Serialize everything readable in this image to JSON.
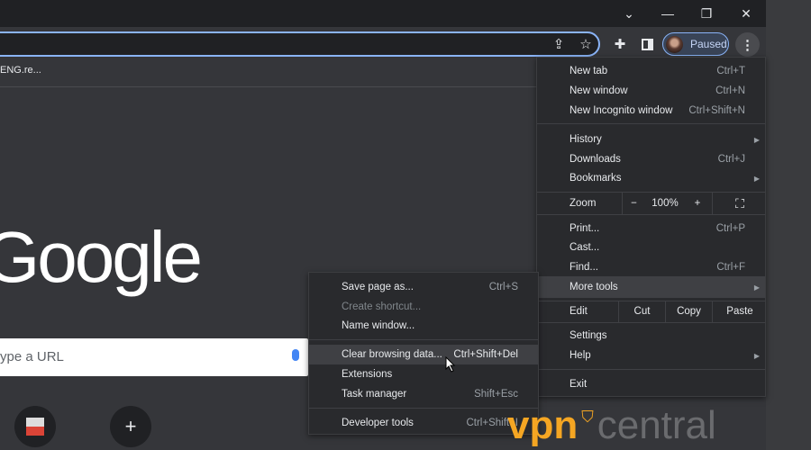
{
  "window": {
    "controls": [
      "chevron-down",
      "minimize",
      "restore",
      "close"
    ]
  },
  "toolbar": {
    "profile_label": "Paused",
    "icons": [
      "share-icon",
      "star-icon",
      "extensions-icon",
      "side-panel-icon",
      "menu-icon"
    ]
  },
  "bookmarks": {
    "item": "ENG.re..."
  },
  "page": {
    "logo": "Google",
    "search_placeholder": "ype a URL"
  },
  "menu": {
    "new_tab": {
      "label": "New tab",
      "shortcut": "Ctrl+T"
    },
    "new_window": {
      "label": "New window",
      "shortcut": "Ctrl+N"
    },
    "incognito": {
      "label": "New Incognito window",
      "shortcut": "Ctrl+Shift+N"
    },
    "history": {
      "label": "History"
    },
    "downloads": {
      "label": "Downloads",
      "shortcut": "Ctrl+J"
    },
    "bookmarks": {
      "label": "Bookmarks"
    },
    "zoom": {
      "label": "Zoom",
      "minus": "−",
      "value": "100%",
      "plus": "+"
    },
    "print": {
      "label": "Print...",
      "shortcut": "Ctrl+P"
    },
    "cast": {
      "label": "Cast..."
    },
    "find": {
      "label": "Find...",
      "shortcut": "Ctrl+F"
    },
    "more_tools": {
      "label": "More tools"
    },
    "edit": {
      "label": "Edit",
      "cut": "Cut",
      "copy": "Copy",
      "paste": "Paste"
    },
    "settings": {
      "label": "Settings"
    },
    "help": {
      "label": "Help"
    },
    "exit": {
      "label": "Exit"
    }
  },
  "submenu": {
    "save_page": {
      "label": "Save page as...",
      "shortcut": "Ctrl+S"
    },
    "create_shortcut": {
      "label": "Create shortcut..."
    },
    "name_window": {
      "label": "Name window..."
    },
    "clear_data": {
      "label": "Clear browsing data...",
      "shortcut": "Ctrl+Shift+Del"
    },
    "extensions": {
      "label": "Extensions"
    },
    "task_manager": {
      "label": "Task manager",
      "shortcut": "Shift+Esc"
    },
    "dev_tools": {
      "label": "Developer tools",
      "shortcut": "Ctrl+Shift+I"
    }
  },
  "watermark": {
    "part1": "vpn",
    "part2": "central"
  },
  "colors": {
    "accent": "#8ab4f8",
    "menu_bg": "#292a2d",
    "highlight": "#3f4044",
    "watermark": "#f5a623"
  }
}
